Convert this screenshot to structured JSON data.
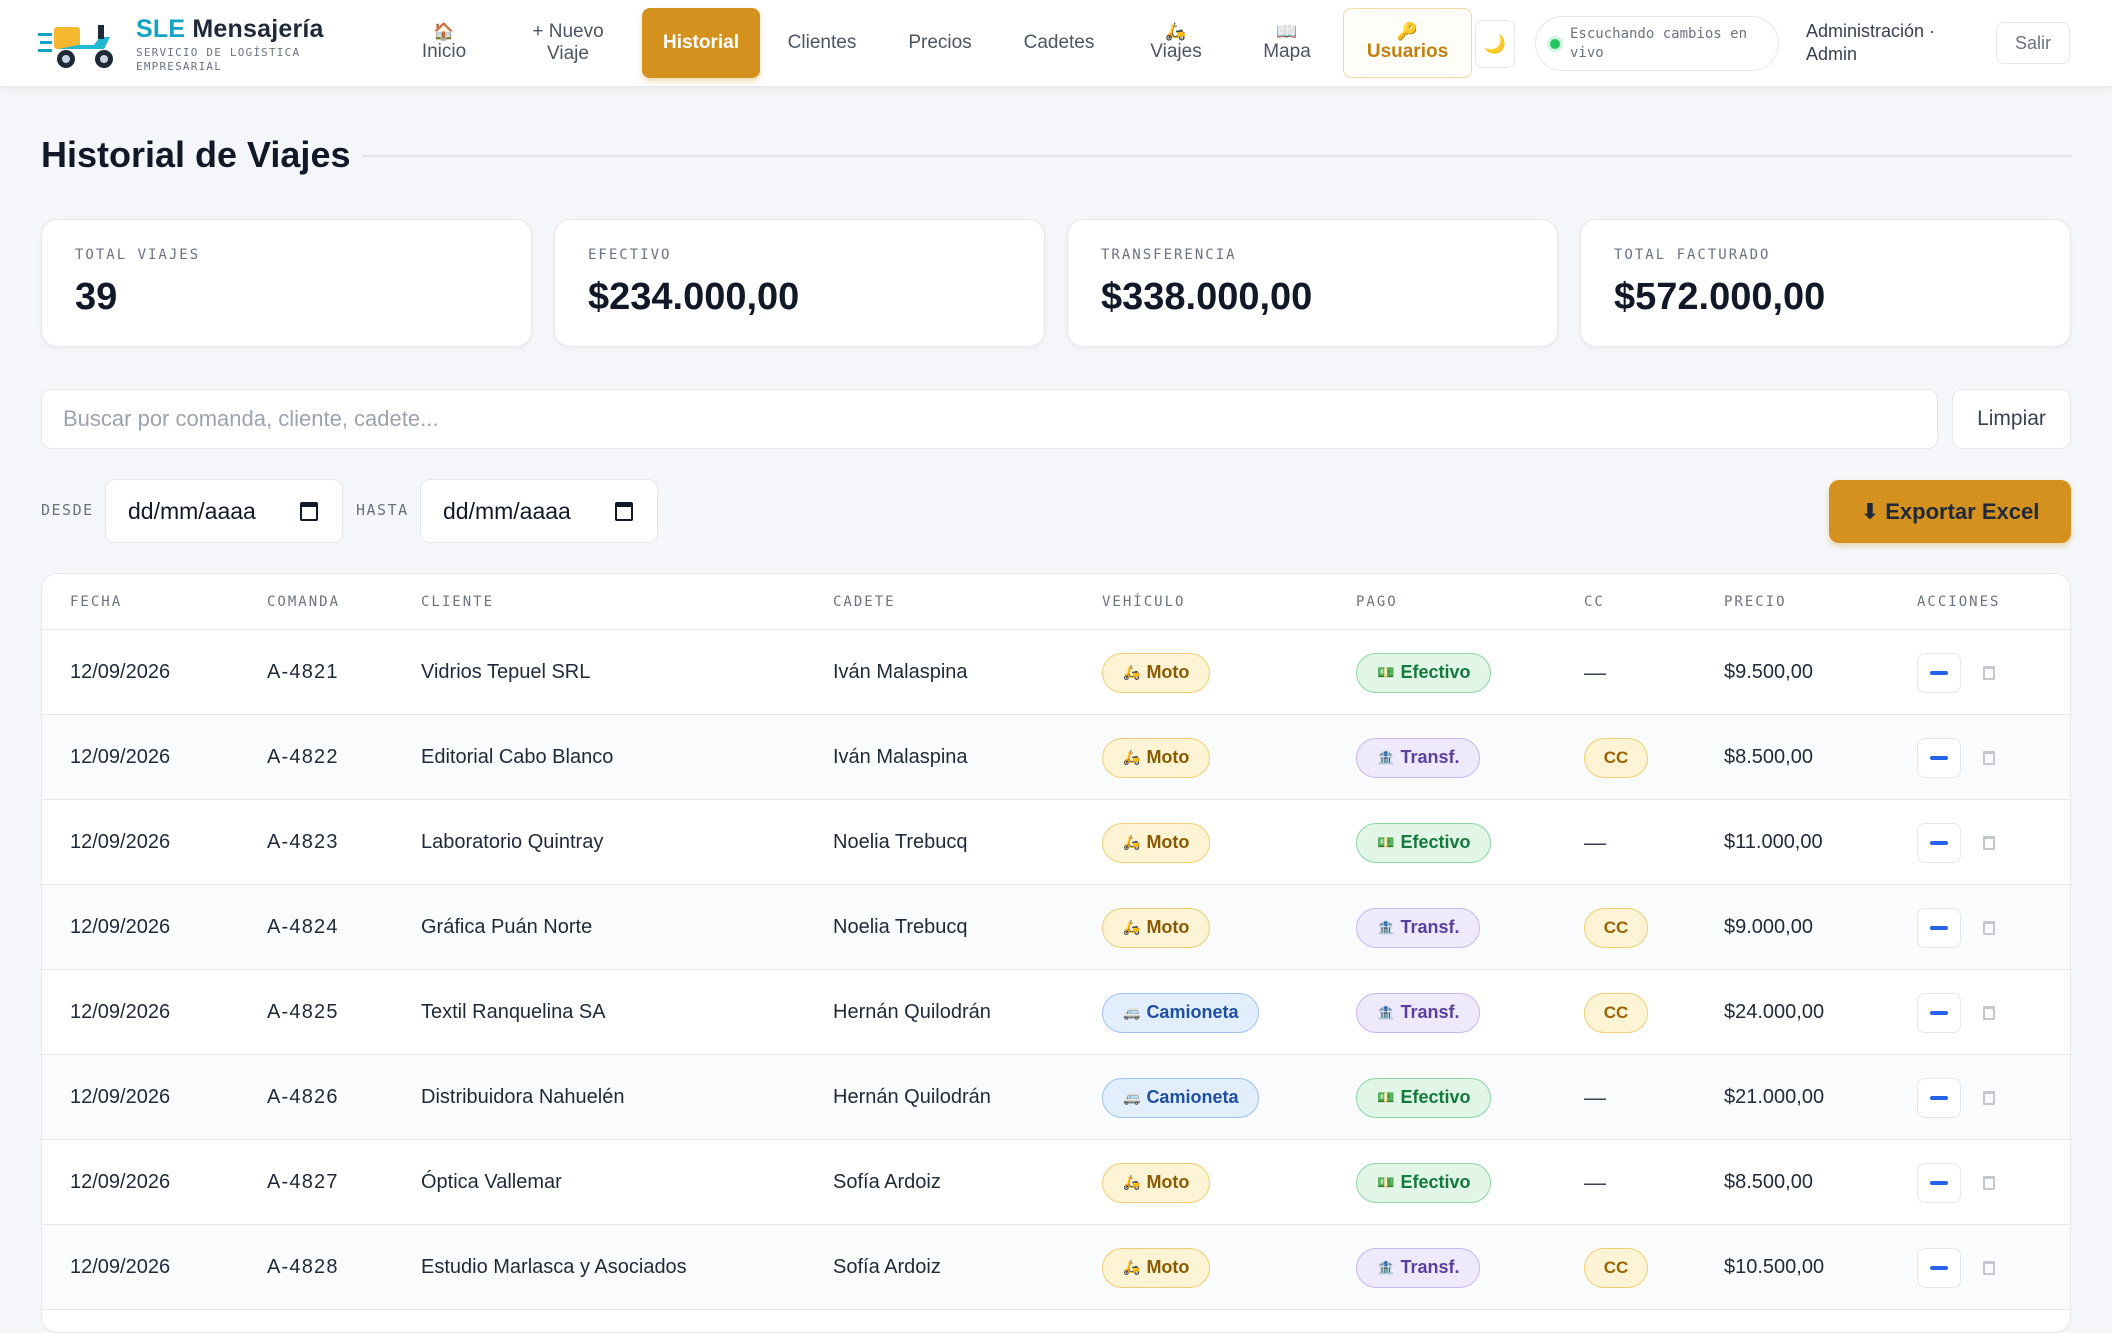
{
  "brand": {
    "sle": "SLE",
    "title": "Mensajería",
    "subtitle": "SERVICIO DE LOGÍSTICA EMPRESARIAL"
  },
  "nav": [
    {
      "icon": "🏠",
      "label": "Inicio"
    },
    {
      "icon": "",
      "label": "+ Nuevo Viaje"
    },
    {
      "icon": "",
      "label": "Historial"
    },
    {
      "icon": "",
      "label": "Clientes"
    },
    {
      "icon": "",
      "label": "Precios"
    },
    {
      "icon": "",
      "label": "Cadetes"
    },
    {
      "icon": "🛵",
      "label": "Viajes"
    },
    {
      "icon": "📖",
      "label": "Mapa"
    },
    {
      "icon": "🔑",
      "label": "Usuarios"
    }
  ],
  "theme_toggle": "🌙",
  "live_status": "Escuchando cambios en vivo",
  "admin_label": "Administración · Admin",
  "logout_label": "Salir",
  "page_title": "Historial de Viajes",
  "stats": [
    {
      "label": "TOTAL VIAJES",
      "value": "39"
    },
    {
      "label": "EFECTIVO",
      "value": "$234.000,00"
    },
    {
      "label": "TRANSFERENCIA",
      "value": "$338.000,00"
    },
    {
      "label": "TOTAL FACTURADO",
      "value": "$572.000,00"
    }
  ],
  "search": {
    "placeholder": "Buscar por comanda, cliente, cadete...",
    "clear_label": "Limpiar"
  },
  "filters": {
    "from_label": "DESDE",
    "to_label": "HASTA",
    "date_placeholder": "dd/mm/aaaa"
  },
  "export_label": "⬇ Exportar Excel",
  "table": {
    "headers": [
      "FECHA",
      "COMANDA",
      "CLIENTE",
      "CADETE",
      "VEHÍCULO",
      "PAGO",
      "CC",
      "PRECIO",
      "ACCIONES"
    ],
    "rows": [
      {
        "fecha": "12/09/2026",
        "comanda": "A-4821",
        "cliente": "Vidrios Tepuel SRL",
        "cadete": "Iván Malaspina",
        "vehiculo": "Moto",
        "pago": "Efectivo",
        "cc": "—",
        "precio": "$9.500,00"
      },
      {
        "fecha": "12/09/2026",
        "comanda": "A-4822",
        "cliente": "Editorial Cabo Blanco",
        "cadete": "Iván Malaspina",
        "vehiculo": "Moto",
        "pago": "Transf.",
        "cc": "CC",
        "precio": "$8.500,00"
      },
      {
        "fecha": "12/09/2026",
        "comanda": "A-4823",
        "cliente": "Laboratorio Quintray",
        "cadete": "Noelia Trebucq",
        "vehiculo": "Moto",
        "pago": "Efectivo",
        "cc": "—",
        "precio": "$11.000,00"
      },
      {
        "fecha": "12/09/2026",
        "comanda": "A-4824",
        "cliente": "Gráfica Puán Norte",
        "cadete": "Noelia Trebucq",
        "vehiculo": "Moto",
        "pago": "Transf.",
        "cc": "CC",
        "precio": "$9.000,00"
      },
      {
        "fecha": "12/09/2026",
        "comanda": "A-4825",
        "cliente": "Textil Ranquelina SA",
        "cadete": "Hernán Quilodrán",
        "vehiculo": "Camioneta",
        "pago": "Transf.",
        "cc": "CC",
        "precio": "$24.000,00"
      },
      {
        "fecha": "12/09/2026",
        "comanda": "A-4826",
        "cliente": "Distribuidora Nahuelén",
        "cadete": "Hernán Quilodrán",
        "vehiculo": "Camioneta",
        "pago": "Efectivo",
        "cc": "—",
        "precio": "$21.000,00"
      },
      {
        "fecha": "12/09/2026",
        "comanda": "A-4827",
        "cliente": "Óptica Vallemar",
        "cadete": "Sofía Ardoiz",
        "vehiculo": "Moto",
        "pago": "Efectivo",
        "cc": "—",
        "precio": "$8.500,00"
      },
      {
        "fecha": "12/09/2026",
        "comanda": "A-4828",
        "cliente": "Estudio Marlasca y Asociados",
        "cadete": "Sofía Ardoiz",
        "vehiculo": "Moto",
        "pago": "Transf.",
        "cc": "CC",
        "precio": "$10.500,00"
      }
    ]
  },
  "icons": {
    "moto": "🛵",
    "camioneta": "🚐",
    "efectivo": "💵",
    "transferencia": "🏦"
  },
  "colors": {
    "accent": "#d4911e",
    "brand": "#14a3c7",
    "live": "#22c55e"
  }
}
